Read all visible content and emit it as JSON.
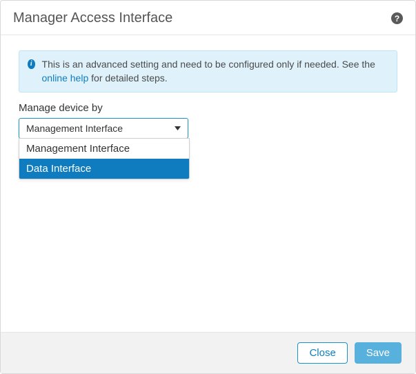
{
  "header": {
    "title": "Manager Access Interface",
    "help_glyph": "?"
  },
  "info": {
    "icon_glyph": "i",
    "text_pre": "This is an advanced setting and need to be configured only if needed. See the ",
    "link_text": "online help",
    "text_post": " for detailed steps."
  },
  "field": {
    "label": "Manage device by",
    "selected": "Management Interface",
    "options": [
      {
        "label": "Management Interface",
        "highlight": false
      },
      {
        "label": "Data Interface",
        "highlight": true
      }
    ]
  },
  "footer": {
    "close_label": "Close",
    "save_label": "Save"
  }
}
